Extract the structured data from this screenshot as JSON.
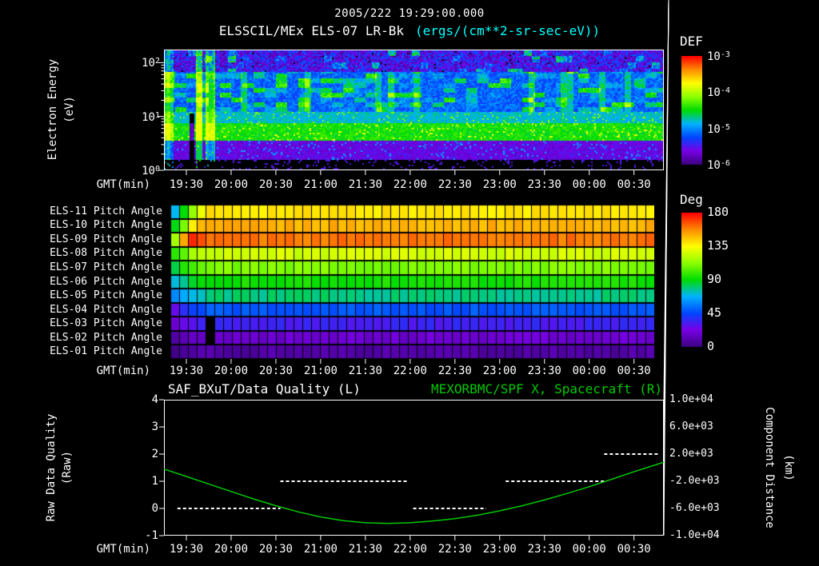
{
  "header": {
    "timestamp": "2005/222 19:29:00.000",
    "instrument_title": "ELSSCIL/MEx ELS-07 LR-Bk",
    "units_label": "(ergs/(cm**2-sr-sec-eV))"
  },
  "time_axis": {
    "label": "GMT(min)",
    "tick_labels": [
      "19:30",
      "20:00",
      "20:30",
      "21:00",
      "21:30",
      "22:00",
      "22:30",
      "23:00",
      "23:30",
      "00:00",
      "00:30"
    ],
    "tick_minutes": [
      0,
      30,
      60,
      90,
      120,
      150,
      180,
      210,
      240,
      270,
      300
    ],
    "range_minutes": [
      -15,
      320
    ]
  },
  "colors": {
    "background": "#000000",
    "white": "#ffffff",
    "cyan": "#00ffff",
    "accent_green": "#00c800"
  },
  "chart_data": [
    {
      "type": "heatmap",
      "name": "electron-energy-spectrogram",
      "ylabel_lines": [
        "Electron Energy",
        "(eV)"
      ],
      "y_scale": "log",
      "y_range_ev": [
        1,
        175
      ],
      "y_ticks": [
        {
          "base": "10",
          "exp": "0"
        },
        {
          "base": "10",
          "exp": "1"
        },
        {
          "base": "10",
          "exp": "2"
        }
      ],
      "colorbar": {
        "title": "DEF",
        "log10_range": [
          -6,
          -3
        ],
        "ticks": [
          {
            "base": "10",
            "exp": "-3"
          },
          {
            "base": "10",
            "exp": "-4"
          },
          {
            "base": "10",
            "exp": "-5"
          },
          {
            "base": "10",
            "exp": "-6"
          }
        ]
      },
      "bands": [
        {
          "e_min": 1.0,
          "e_max": 1.6,
          "log10_def": -6.3,
          "style": "sparse"
        },
        {
          "e_min": 1.6,
          "e_max": 3.6,
          "log10_def": -5.6,
          "style": "smooth"
        },
        {
          "e_min": 3.6,
          "e_max": 8.0,
          "log10_def": -4.45,
          "style": "smooth"
        },
        {
          "e_min": 8.0,
          "e_max": 13.0,
          "log10_def": -4.8,
          "style": "smooth"
        },
        {
          "e_min": 13.0,
          "e_max": 70.0,
          "log10_def": -5.15,
          "style": "patchy"
        },
        {
          "e_min": 70.0,
          "e_max": 175.0,
          "log10_def": -5.55,
          "style": "speckle"
        }
      ],
      "events": [
        {
          "t_min": -15,
          "width_min": 6,
          "log10_boost": 0.9
        },
        {
          "t_min": 2,
          "width_min": 3,
          "log10_boost": -1.3
        },
        {
          "t_min": 6,
          "width_min": 4,
          "log10_boost": 1.1
        },
        {
          "t_min": 12,
          "width_min": 7,
          "log10_boost": 0.9
        }
      ]
    },
    {
      "type": "heatmap",
      "name": "pitch-angle-panels",
      "colorbar": {
        "title": "Deg",
        "range_deg": [
          0,
          180
        ],
        "ticks": [
          "180",
          "135",
          "90",
          "45",
          "0"
        ]
      },
      "n_time_cells": 55,
      "rows": [
        {
          "label": "ELS-11 Pitch Angle",
          "steady_deg": 140,
          "start_seq_deg": [
            72,
            92,
            112,
            130
          ]
        },
        {
          "label": "ELS-10 Pitch Angle",
          "steady_deg": 150,
          "start_seq_deg": [
            86,
            112,
            136,
            148
          ]
        },
        {
          "label": "ELS-09 Pitch Angle",
          "steady_deg": 161,
          "start_seq_deg": [
            120,
            152,
            172,
            166
          ]
        },
        {
          "label": "ELS-08 Pitch Angle",
          "steady_deg": 126,
          "start_seq_deg": [
            96,
            106,
            116,
            122
          ]
        },
        {
          "label": "ELS-07 Pitch Angle",
          "steady_deg": 110,
          "start_seq_deg": [
            86,
            96,
            103,
            107
          ]
        },
        {
          "label": "ELS-06 Pitch Angle",
          "steady_deg": 93,
          "start_seq_deg": [
            70,
            79,
            86,
            90
          ]
        },
        {
          "label": "ELS-05 Pitch Angle",
          "steady_deg": 79,
          "start_seq_deg": [
            56,
            63,
            70,
            75
          ]
        },
        {
          "label": "ELS-04 Pitch Angle",
          "steady_deg": 48,
          "start_seq_deg": [
            28,
            35,
            42,
            46
          ]
        },
        {
          "label": "ELS-03 Pitch Angle",
          "steady_deg": 33,
          "start_seq_deg": [
            20,
            24,
            28,
            31
          ]
        },
        {
          "label": "ELS-02 Pitch Angle",
          "steady_deg": 18,
          "start_seq_deg": [
            9,
            12,
            15,
            17
          ]
        },
        {
          "label": "ELS-01 Pitch Angle",
          "steady_deg": 8,
          "start_seq_deg": [
            4,
            5,
            6,
            7
          ]
        }
      ],
      "gap_cells": [
        {
          "row": 8,
          "col": 4
        },
        {
          "row": 9,
          "col": 4
        }
      ]
    },
    {
      "type": "line",
      "title_left": "SAF_BXuT/Data Quality (L)",
      "title_right": "MEXORBMC/SPF X, Spacecraft (R)",
      "left_axis": {
        "label_lines": [
          "Raw Data Quality",
          "(Raw)"
        ],
        "ticks": [
          "4",
          "3",
          "2",
          "1",
          "0",
          "-1"
        ],
        "range": [
          -1,
          4
        ]
      },
      "right_axis": {
        "label_lines": [
          "Component Distance",
          "(km)"
        ],
        "ticks": [
          "1.0e+04",
          "6.0e+03",
          "2.0e+03",
          "-2.0e+03",
          "-6.0e+03",
          "-1.0e+04"
        ],
        "range": [
          -10000,
          10000
        ]
      },
      "series": [
        {
          "name": "MEXORBMC/SPF X Spacecraft",
          "axis": "right",
          "style": "solid",
          "t": [
            -15,
            0,
            15,
            30,
            45,
            60,
            75,
            90,
            105,
            120,
            135,
            150,
            165,
            180,
            195,
            210,
            225,
            240,
            255,
            270,
            285,
            300,
            310,
            320
          ],
          "km": [
            -200,
            -1300,
            -2400,
            -3500,
            -4600,
            -5600,
            -6500,
            -7250,
            -7800,
            -8100,
            -8200,
            -8100,
            -7850,
            -7500,
            -7000,
            -6350,
            -5600,
            -4750,
            -3800,
            -2800,
            -1700,
            -600,
            100,
            800
          ]
        },
        {
          "name": "SAF_BXuT Data Quality",
          "axis": "left",
          "style": "dashed",
          "segments": [
            {
              "value": 0,
              "t_start": -6,
              "t_end": 63
            },
            {
              "value": 1,
              "t_start": 63,
              "t_end": 149
            },
            {
              "value": 0,
              "t_start": 152,
              "t_end": 201
            },
            {
              "value": 1,
              "t_start": 214,
              "t_end": 280
            },
            {
              "value": 2,
              "t_start": 280,
              "t_end": 317
            }
          ]
        }
      ]
    }
  ]
}
